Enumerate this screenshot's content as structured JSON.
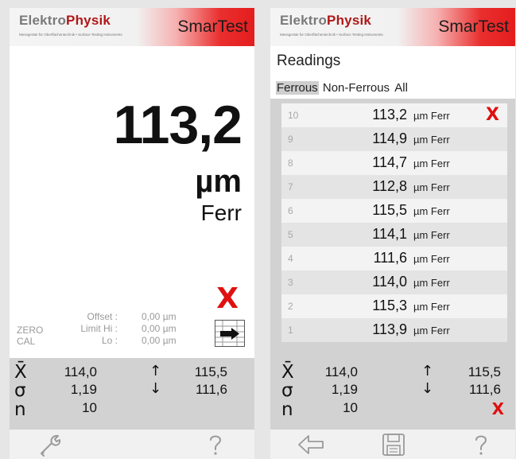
{
  "brand": {
    "name_part1": "Elektro",
    "name_part2": "Physik",
    "tagline": "Messgeräte für Oberflächentechnik • Surface Testing Instruments",
    "app_name": "SmarTest"
  },
  "measurement": {
    "value": "113,2",
    "unit": "µm",
    "mode": "Ferr"
  },
  "calibration": {
    "zero_label": "ZERO",
    "cal_label": "CAL",
    "offset_label": "Offset :",
    "limit_hi_label": "Limit Hi :",
    "lo_label": "Lo :",
    "offset_value": "0,00 µm",
    "limit_hi_value": "0,00 µm",
    "lo_value": "0,00 µm"
  },
  "stats": {
    "mean_symbol": "X̄",
    "sigma_symbol": "σ",
    "n_symbol": "n",
    "mean": "114,0",
    "sigma": "1,19",
    "n": "10",
    "max_arrow": "↑",
    "min_arrow": "↓",
    "max": "115,5",
    "min": "111,6"
  },
  "readings": {
    "title": "Readings",
    "tabs": [
      "Ferrous",
      "Non-Ferrous",
      "All"
    ],
    "active_tab": "Ferrous",
    "rows": [
      {
        "index": "10",
        "value": "113,2",
        "unit": "µm Ferr"
      },
      {
        "index": "9",
        "value": "114,9",
        "unit": "µm Ferr"
      },
      {
        "index": "8",
        "value": "114,7",
        "unit": "µm Ferr"
      },
      {
        "index": "7",
        "value": "112,8",
        "unit": "µm Ferr"
      },
      {
        "index": "6",
        "value": "115,5",
        "unit": "µm Ferr"
      },
      {
        "index": "5",
        "value": "114,1",
        "unit": "µm Ferr"
      },
      {
        "index": "4",
        "value": "111,6",
        "unit": "µm Ferr"
      },
      {
        "index": "3",
        "value": "114,0",
        "unit": "µm Ferr"
      },
      {
        "index": "2",
        "value": "115,3",
        "unit": "µm Ferr"
      },
      {
        "index": "1",
        "value": "113,9",
        "unit": "µm Ferr"
      }
    ]
  },
  "icons": {
    "delete": "close-x-icon",
    "export": "export-arrow-icon",
    "settings": "wrench-icon",
    "help": "question-mark-icon",
    "back": "back-arrow-icon",
    "save": "floppy-disk-icon"
  },
  "colors": {
    "accent_red": "#e41d1d",
    "brand_red": "#b11818",
    "stats_bg": "#d2d2d2"
  },
  "glyphs": {
    "delete": "X"
  }
}
